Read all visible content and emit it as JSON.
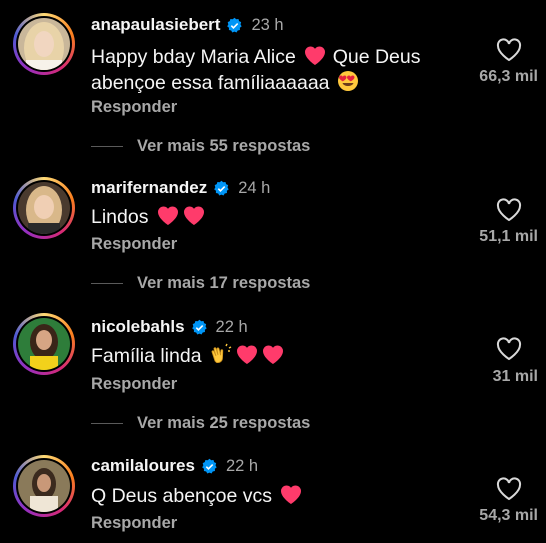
{
  "colors": {
    "background": "#000000",
    "text_primary": "#f5f5f5",
    "text_secondary": "#a8a8a8",
    "verified_blue": "#0095f6",
    "heart_pink": "#ff3b5c"
  },
  "comments": [
    {
      "username": "anapaulasiebert",
      "verified": true,
      "time": "23 h",
      "text": "Happy bday Maria Alice",
      "text_after": "Que Deus abençoe essa famíliaaaaaa",
      "emojis_inline": [
        "pink-heart",
        "heart-eyes"
      ],
      "reply_label": "Responder",
      "likes": "66,3 mil",
      "more_replies": "Ver mais 55 respostas"
    },
    {
      "username": "marifernandez",
      "verified": true,
      "time": "24 h",
      "text": "Lindos",
      "emojis_inline": [
        "pink-heart",
        "pink-heart"
      ],
      "reply_label": "Responder",
      "likes": "51,1 mil",
      "more_replies": "Ver mais 17 respostas"
    },
    {
      "username": "nicolebahls",
      "verified": true,
      "time": "22 h",
      "text": "Família linda",
      "emojis_inline": [
        "clapping-hands",
        "pink-heart",
        "pink-heart"
      ],
      "reply_label": "Responder",
      "likes": "31 mil",
      "more_replies": "Ver mais 25 respostas"
    },
    {
      "username": "camilaloures",
      "verified": true,
      "time": "22 h",
      "text": "Q Deus abençoe vcs",
      "emojis_inline": [
        "pink-heart"
      ],
      "reply_label": "Responder",
      "likes": "54,3 mil"
    }
  ]
}
